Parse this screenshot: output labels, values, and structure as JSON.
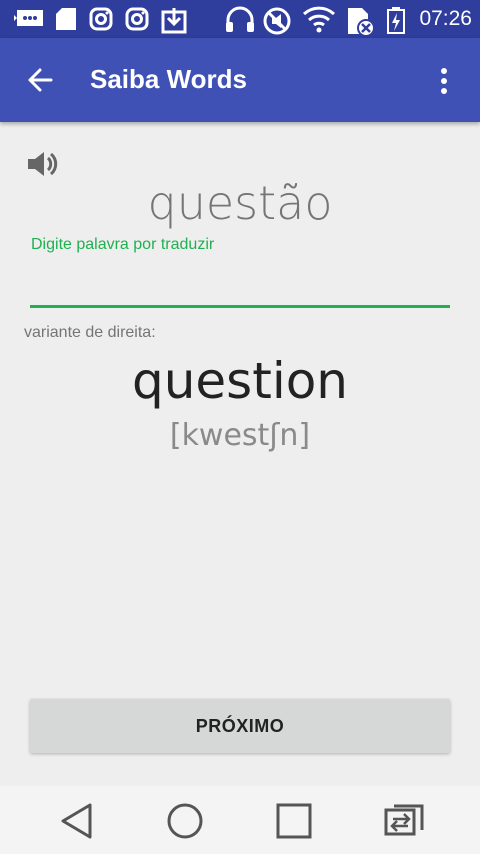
{
  "status_bar": {
    "time": "07:26",
    "icons": [
      "message-icon",
      "sd-card-icon",
      "instagram-icon",
      "instagram-icon",
      "download-icon",
      "headphones-icon",
      "mute-icon",
      "wifi-icon",
      "sim-icon",
      "battery-charging-icon"
    ]
  },
  "app_bar": {
    "title": "Saiba Words",
    "back_icon": "arrow-back-icon",
    "menu_icon": "overflow-menu-icon"
  },
  "card": {
    "speaker_icon": "speaker-icon",
    "source_word": "questão",
    "input_hint": "Digite palavra por traduzir",
    "input_value": "",
    "variant_label": "variante de direita:",
    "translation": "question",
    "transcription": "[kwestʃn]"
  },
  "actions": {
    "next_label": "PRÓXIMO"
  },
  "nav_bar": {
    "icons": [
      "back-triangle-icon",
      "home-circle-icon",
      "recents-square-icon",
      "switch-app-icon"
    ]
  },
  "colors": {
    "status_bar": "#2f3d9c",
    "app_bar": "#3f51b5",
    "accent": "#20b050",
    "background": "#eeeeee"
  }
}
